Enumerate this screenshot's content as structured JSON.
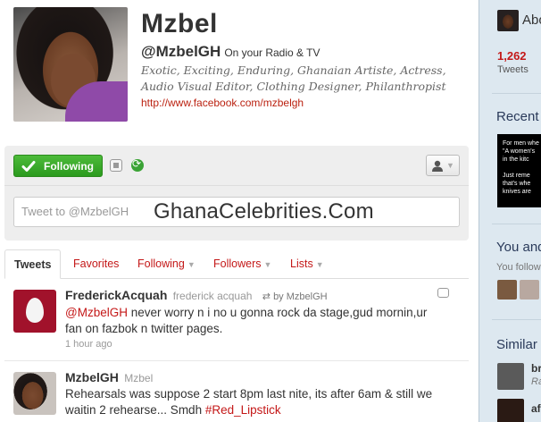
{
  "profile": {
    "name": "Mzbel",
    "screen_name": "@MzbelGH",
    "location": "On your Radio & TV",
    "bio": "Exotic, Exciting, Enduring, Ghanaian Artiste, Actress, Audio Visual Editor, Clothing Designer, Philanthropist",
    "url": "http://www.facebook.com/mzbelgh"
  },
  "actions": {
    "follow_label": "Following",
    "tweet_placeholder": "Tweet to @MzbelGH",
    "icons": [
      "check-icon",
      "device-icon",
      "retweet-icon",
      "user-icon"
    ]
  },
  "watermark": "GhanaCelebrities.Com",
  "tabs": [
    {
      "label": "Tweets"
    },
    {
      "label": "Favorites"
    },
    {
      "label": "Following"
    },
    {
      "label": "Followers"
    },
    {
      "label": "Lists"
    }
  ],
  "tweets": [
    {
      "name": "FrederickAcquah",
      "handle": "frederick acquah",
      "retweet": "by MzbelGH",
      "mention": "@MzbelGH",
      "text": " never worry n i no u gonna rock da stage,gud mornin,ur fan on fazbok n twitter pages.",
      "time": "1 hour ago"
    },
    {
      "name": "MzbelGH",
      "handle": "Mzbel",
      "text": "Rehearsals was suppose 2 start 8pm last nite, its after 6am & still we waitin 2 rehearse... Smdh ",
      "hashtag": "#Red_Lipstick"
    }
  ],
  "sidebar": {
    "about": "Abo",
    "tweet_count": "1,262",
    "tweets_label": "Tweets",
    "recent_heading": "Recent",
    "recent_image_lines": [
      "For men whe",
      "\"A women's",
      "in the kitc",
      "",
      "Just reme",
      "that's whe",
      "knives are"
    ],
    "you_and_heading": "You and",
    "you_follow": "You follow",
    "similar_heading": "Similar",
    "similar": [
      {
        "name": "bri",
        "sub": "Ra"
      },
      {
        "name": "af",
        "sub": ""
      }
    ]
  },
  "colors": {
    "accent": "#c41818",
    "follow_green": "#3aa335",
    "sidebar_bg": "#dde8f0"
  }
}
